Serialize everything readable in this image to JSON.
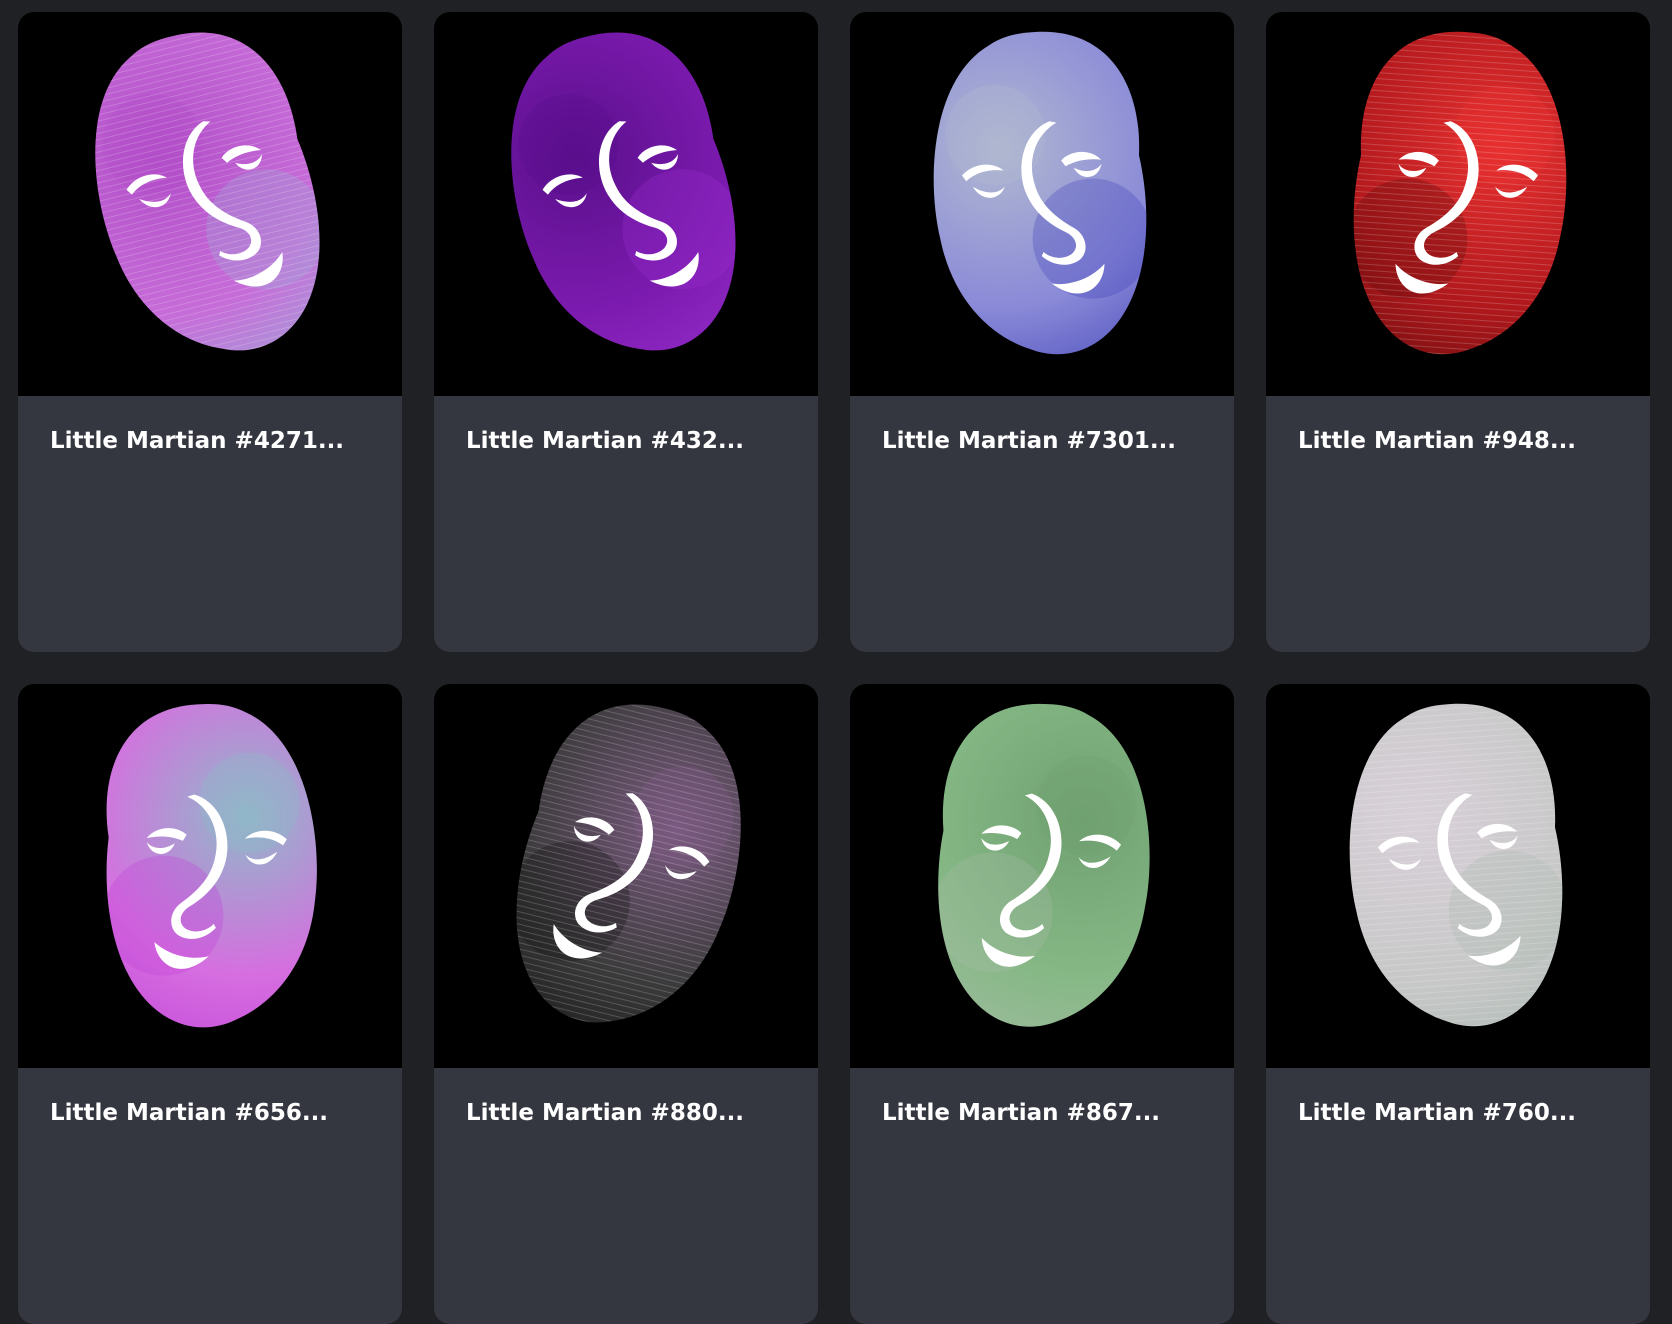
{
  "cards": [
    {
      "title": "Little Martian #4271...",
      "palette": [
        "#c66cd8",
        "#9ab0d8",
        "#b24ec8"
      ],
      "tilt": -14,
      "flip": false,
      "stripes": true
    },
    {
      "title": "Little Martian #432...",
      "palette": [
        "#7d1bb0",
        "#9b30d0",
        "#5a0f8c"
      ],
      "tilt": -14,
      "flip": false,
      "stripes": false
    },
    {
      "title": "Little Martian #7301...",
      "palette": [
        "#8a8ad8",
        "#4040b8",
        "#b0b8d0"
      ],
      "tilt": -4,
      "flip": false,
      "stripes": false
    },
    {
      "title": "Little Martian #948...",
      "palette": [
        "#b0181c",
        "#5a0a0a",
        "#e83030"
      ],
      "tilt": 4,
      "flip": true,
      "stripes": true
    },
    {
      "title": "Little Martian #656...",
      "palette": [
        "#d66ee0",
        "#c040d8",
        "#90b8c8"
      ],
      "tilt": -2,
      "flip": true,
      "stripes": false
    },
    {
      "title": "Little Martian #880...",
      "palette": [
        "#3a3a3a",
        "#111111",
        "#7a5a80"
      ],
      "tilt": 14,
      "flip": true,
      "stripes": true
    },
    {
      "title": "Little Martian #867...",
      "palette": [
        "#86b886",
        "#a8bca8",
        "#70a070"
      ],
      "tilt": 2,
      "flip": true,
      "stripes": false
    },
    {
      "title": "Little Martian #760...",
      "palette": [
        "#c8c8c8",
        "#a8b8b0",
        "#d8d0d8"
      ],
      "tilt": -4,
      "flip": false,
      "stripes": true
    }
  ]
}
